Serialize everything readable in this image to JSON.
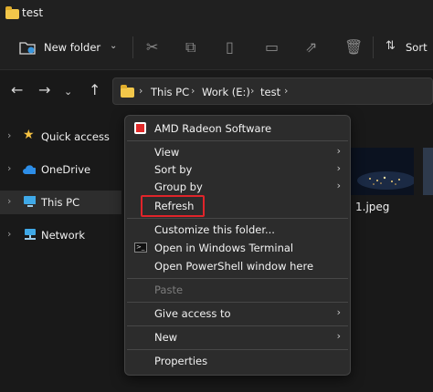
{
  "window": {
    "title": "test"
  },
  "toolbar": {
    "new_folder_label": "New folder",
    "sort_label": "Sort"
  },
  "address": {
    "crumbs": [
      "This PC",
      "Work (E:)",
      "test"
    ]
  },
  "sidebar": {
    "items": [
      {
        "label": "Quick access",
        "icon": "star-icon"
      },
      {
        "label": "OneDrive",
        "icon": "cloud-icon"
      },
      {
        "label": "This PC",
        "icon": "monitor-icon",
        "selected": true
      },
      {
        "label": "Network",
        "icon": "network-icon"
      }
    ]
  },
  "content": {
    "file_label": "1.jpeg"
  },
  "context_menu": {
    "amd": "AMD Radeon Software",
    "view": "View",
    "sort_by": "Sort by",
    "group_by": "Group by",
    "refresh": "Refresh",
    "customize": "Customize this folder...",
    "terminal": "Open in Windows Terminal",
    "powershell": "Open PowerShell window here",
    "paste": "Paste",
    "give_access": "Give access to",
    "new": "New",
    "properties": "Properties"
  },
  "colors": {
    "highlight_border": "#e0242a",
    "folder": "#f2c74a",
    "background": "#191919",
    "menu_bg": "#2c2c2c"
  }
}
